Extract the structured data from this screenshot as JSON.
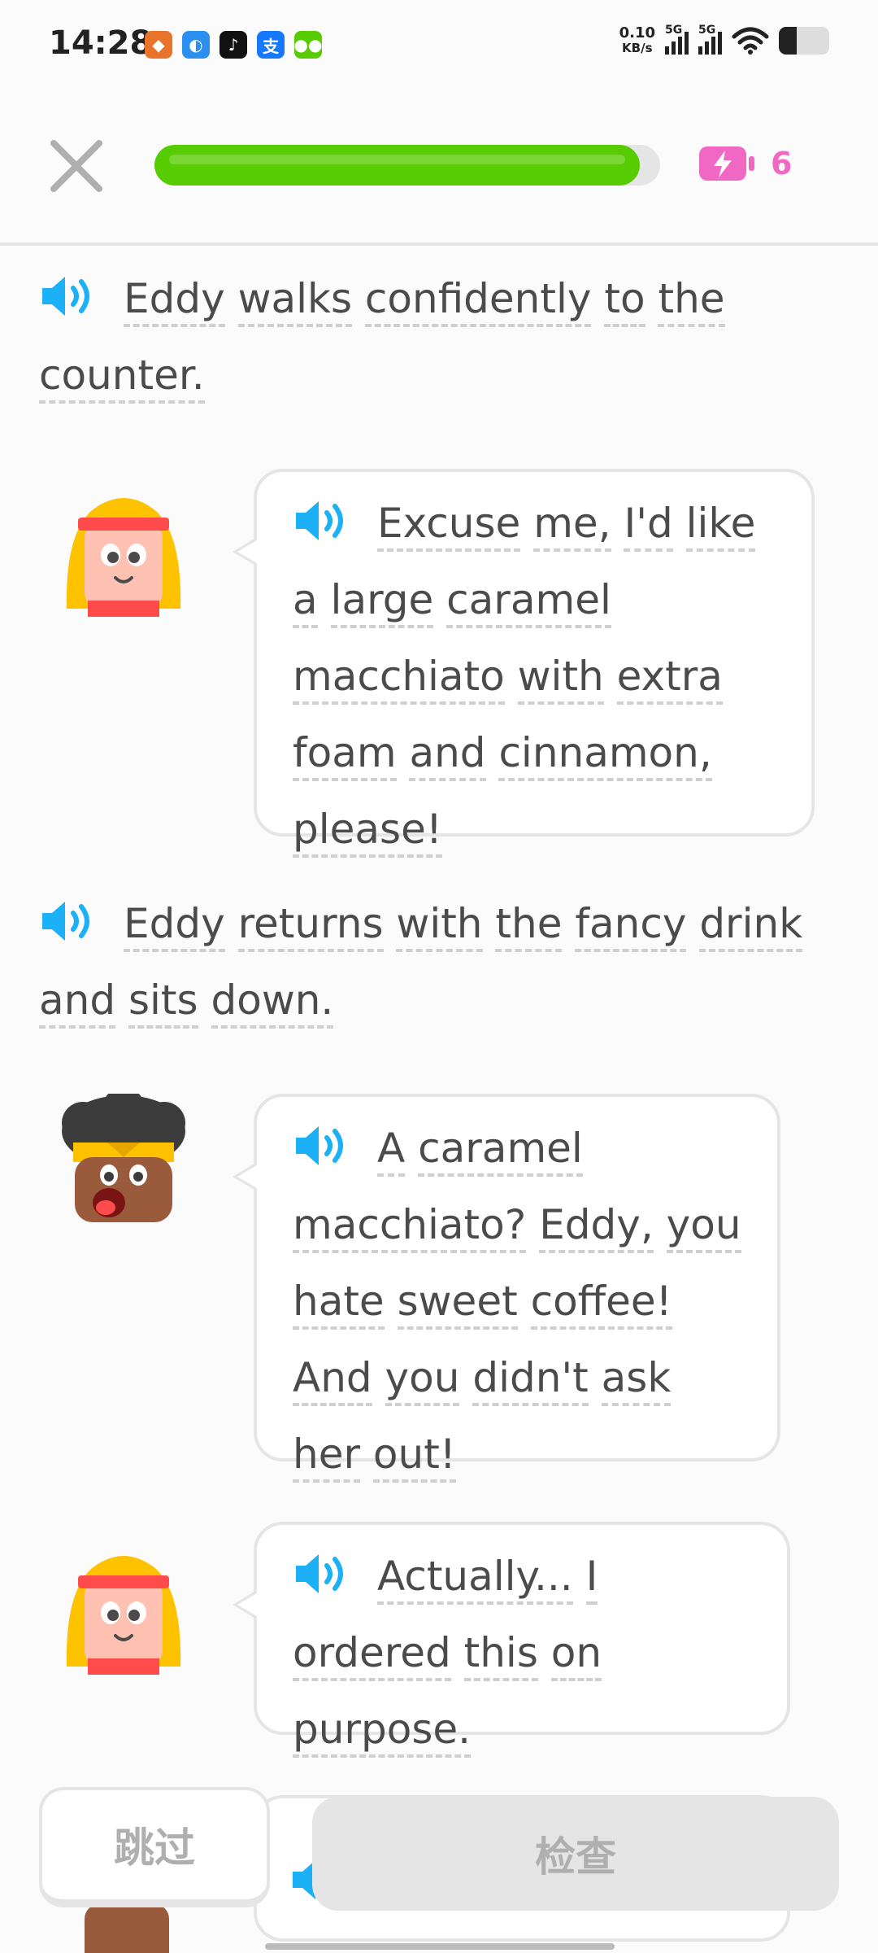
{
  "status_bar": {
    "time": "14:28",
    "net_speed_value": "0.10",
    "net_speed_unit": "KB/s",
    "sim1": "5G",
    "sim2": "5G",
    "battery_level": 0.35,
    "app_icons": [
      "tiger-app-icon",
      "browser-app-icon",
      "tiktok-icon",
      "alipay-icon",
      "duolingo-icon"
    ]
  },
  "header": {
    "progress": 0.96,
    "energy_count": "6",
    "colors": {
      "progress": "#58cc02",
      "energy": "#f168c4"
    }
  },
  "story": {
    "narration_1": [
      "Eddy",
      "walks",
      "confidently",
      "to",
      "the",
      "counter."
    ],
    "bubble_1": [
      "Excuse",
      "me,",
      "I'd",
      "like",
      "a",
      "large",
      "caramel",
      "macchiato",
      "with",
      "extra",
      "foam",
      "and",
      "cinnamon,",
      "please!"
    ],
    "narration_2": [
      "Eddy",
      "returns",
      "with",
      "the",
      "fancy",
      "drink",
      "and",
      "sits",
      "down."
    ],
    "bubble_2": [
      "A",
      "caramel",
      "macchiato?",
      "Eddy,",
      "you",
      "hate",
      "sweet",
      "coffee!",
      "And",
      "you",
      "didn't",
      "ask",
      "her",
      "out!"
    ],
    "bubble_3": [
      "Actually...",
      "I",
      "ordered",
      "this",
      "on",
      "purpose."
    ]
  },
  "buttons": {
    "skip": "跳过",
    "check": "检查"
  },
  "colors": {
    "speaker": "#1cb0f6",
    "text": "#4b4b4b"
  }
}
